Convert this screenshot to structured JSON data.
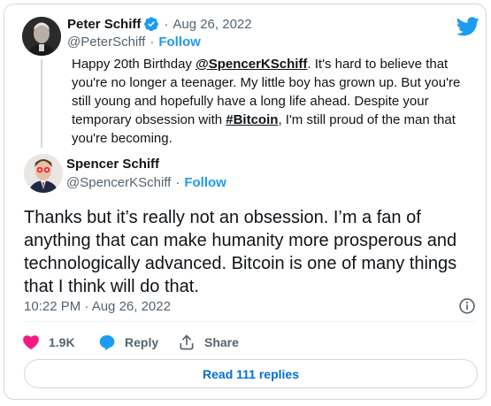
{
  "parent_tweet": {
    "author_name": "Peter Schiff",
    "handle": "@PeterSchiff",
    "separator": "·",
    "date": "Aug 26, 2022",
    "follow_label": "Follow",
    "text_segments": [
      {
        "text": "Happy 20th Birthday "
      },
      {
        "text": "@SpencerKSchiff"
      },
      {
        "text": ". It's hard to believe that you're no longer a teenager. My little boy has grown up. But you're still young and hopefully have a long life ahead. Despite your temporary obsession with "
      },
      {
        "text": "#Bitcoin"
      },
      {
        "text": ", I'm still proud of the man that you're becoming."
      }
    ]
  },
  "reply_tweet": {
    "author_name": "Spencer Schiff",
    "handle": "@SpencerKSchiff",
    "separator": "·",
    "follow_label": "Follow",
    "text": "Thanks but it’s really not an obsession. I’m a fan of anything that can make humanity more prosperous and technologically advanced. Bitcoin is one of many things that I think will do that.",
    "timestamp": "10:22 PM · Aug 26, 2022"
  },
  "actions": {
    "likes": "1.9K",
    "reply_label": "Reply",
    "share_label": "Share"
  },
  "read_replies_label": "Read 111 replies",
  "colors": {
    "accent": "#1d9bf0",
    "like": "#f91880",
    "text": "#0f1419",
    "secondary": "#536471",
    "border": "#cfd9de"
  },
  "icons": [
    "twitter-bird-icon",
    "verified-badge-icon",
    "info-icon",
    "heart-icon",
    "reply-bubble-icon",
    "share-icon"
  ]
}
